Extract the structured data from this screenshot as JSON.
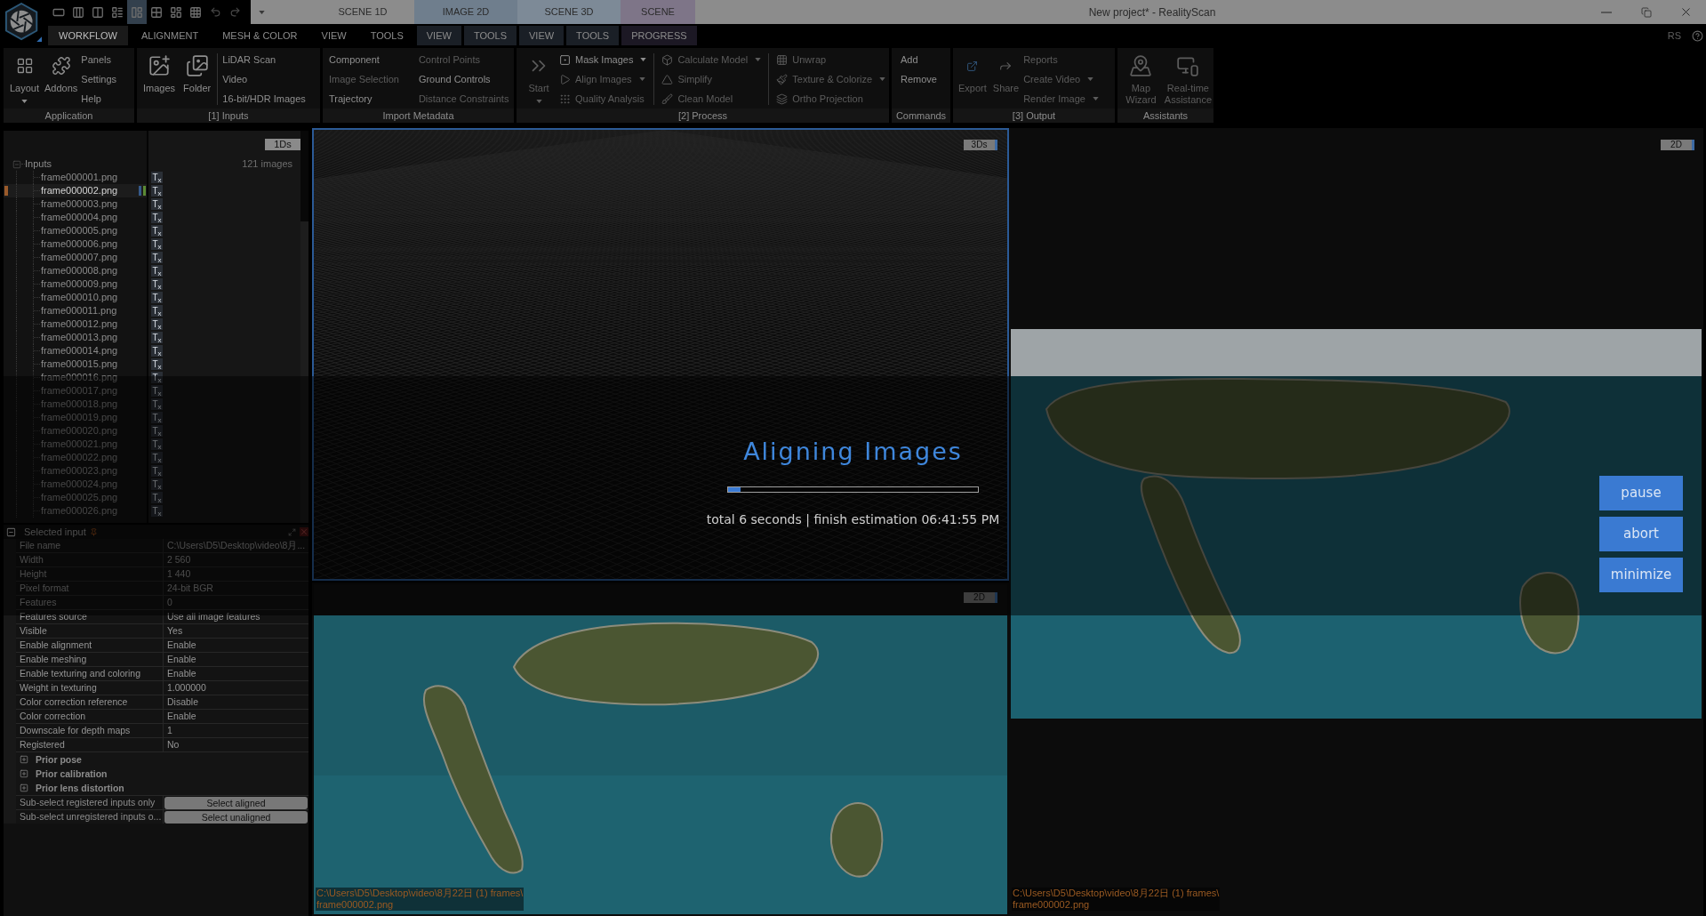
{
  "title_bar": {
    "layout_buttons": [
      {
        "selected": false
      },
      {
        "selected": false
      },
      {
        "selected": false
      },
      {
        "selected": false
      },
      {
        "selected": true
      },
      {
        "selected": false
      },
      {
        "selected": false
      },
      {
        "selected": false
      }
    ],
    "panes": [
      {
        "label": "SCENE 1D",
        "color": "#8c8c8c"
      },
      {
        "label": "IMAGE 2D",
        "color": "#6f7e8d"
      },
      {
        "label": "SCENE 3D",
        "color": "#7d8a97"
      },
      {
        "label": "SCENE",
        "color": "#7e7588"
      }
    ],
    "title": "New project* - RealityScan"
  },
  "tabs_row": {
    "tabs": [
      {
        "label": "WORKFLOW",
        "selected": true
      },
      {
        "label": "ALIGNMENT",
        "selected": false
      },
      {
        "label": "MESH & COLOR",
        "selected": false
      },
      {
        "label": "VIEW",
        "selected": false
      },
      {
        "label": "TOOLS",
        "selected": false
      },
      {
        "label": "VIEW",
        "selected": false,
        "color": "#1a1f26"
      },
      {
        "label": "TOOLS",
        "selected": false,
        "color": "#1a1f26"
      },
      {
        "label": "VIEW",
        "selected": false,
        "color": "#1a1f26"
      },
      {
        "label": "TOOLS",
        "selected": false,
        "color": "#1a1f26"
      },
      {
        "label": "PROGRESS",
        "selected": false,
        "color": "#1c1824"
      }
    ],
    "account": "RS"
  },
  "ribbon": [
    {
      "label": "Application",
      "sections": [
        {
          "kind": "large",
          "label": "Layout",
          "dropdown": true,
          "disabled": false
        },
        {
          "kind": "large",
          "label": "Addons",
          "dropdown": false,
          "disabled": false
        },
        {
          "kind": "stack",
          "items": [
            {
              "label": "Panels",
              "dropdown": false,
              "disabled": false
            },
            {
              "label": "Settings",
              "dropdown": false,
              "disabled": false
            },
            {
              "label": "Help",
              "dropdown": false,
              "disabled": false
            }
          ]
        }
      ]
    },
    {
      "label": "[1] Inputs",
      "sections": [
        {
          "kind": "large",
          "label": "Images",
          "dropdown": false,
          "disabled": false
        },
        {
          "kind": "large",
          "label": "Folder",
          "dropdown": false,
          "disabled": false
        },
        {
          "kind": "stack",
          "separator": true,
          "items": [
            {
              "label": "LiDAR Scan",
              "dropdown": false,
              "disabled": false
            },
            {
              "label": "Video",
              "dropdown": false,
              "disabled": false
            },
            {
              "label": "16-bit/HDR Images",
              "dropdown": false,
              "disabled": false
            }
          ]
        }
      ]
    },
    {
      "label": "Import Metadata",
      "sections": [
        {
          "kind": "stack",
          "items": [
            {
              "label": "Component",
              "dropdown": false,
              "disabled": false
            },
            {
              "label": "Image Selection",
              "dropdown": false,
              "disabled": true
            },
            {
              "label": "Trajectory",
              "dropdown": false,
              "disabled": false
            }
          ]
        },
        {
          "kind": "stack",
          "items": [
            {
              "label": "Control Points",
              "dropdown": false,
              "disabled": true
            },
            {
              "label": "Ground Controls",
              "dropdown": false,
              "disabled": false
            },
            {
              "label": "Distance Constraints",
              "dropdown": false,
              "disabled": true
            }
          ]
        }
      ]
    },
    {
      "label": "[2] Process",
      "sections": [
        {
          "kind": "large",
          "label": "Start",
          "dropdown": true,
          "disabled": true
        },
        {
          "kind": "stack",
          "items": [
            {
              "label": "Mask Images",
              "dropdown": true,
              "disabled": false
            },
            {
              "label": "Align Images",
              "dropdown": true,
              "disabled": true
            },
            {
              "label": "Quality Analysis",
              "dropdown": false,
              "disabled": true
            }
          ]
        },
        {
          "kind": "stack",
          "separator": true,
          "items": [
            {
              "label": "Calculate Model",
              "dropdown": true,
              "disabled": true
            },
            {
              "label": "Simplify",
              "dropdown": false,
              "disabled": true
            },
            {
              "label": "Clean Model",
              "dropdown": false,
              "disabled": true
            }
          ]
        },
        {
          "kind": "stack",
          "separator": true,
          "items": [
            {
              "label": "Unwrap",
              "dropdown": false,
              "disabled": true
            },
            {
              "label": "Texture & Colorize",
              "dropdown": true,
              "disabled": true
            },
            {
              "label": "Ortho Projection",
              "dropdown": false,
              "disabled": true
            }
          ]
        }
      ]
    },
    {
      "label": "Commands",
      "sections": [
        {
          "kind": "stack",
          "items": [
            {
              "label": "Add",
              "dropdown": false,
              "disabled": false
            },
            {
              "label": "Remove",
              "dropdown": false,
              "disabled": false
            }
          ]
        }
      ]
    },
    {
      "label": "[3] Output",
      "sections": [
        {
          "kind": "large",
          "label": "Export",
          "dropdown": false,
          "disabled": true
        },
        {
          "kind": "large",
          "label": "Share",
          "dropdown": false,
          "disabled": true
        },
        {
          "kind": "stack",
          "items": [
            {
              "label": "Reports",
              "dropdown": false,
              "disabled": true
            },
            {
              "label": "Create Video",
              "dropdown": true,
              "disabled": true
            },
            {
              "label": "Render Image",
              "dropdown": true,
              "disabled": true
            }
          ]
        }
      ]
    },
    {
      "label": "Assistants",
      "sections": [
        {
          "kind": "large",
          "label": "Map Wizard",
          "dropdown": false,
          "disabled": true
        },
        {
          "kind": "large",
          "label": "Real-time Assistance",
          "dropdown": false,
          "disabled": true
        }
      ]
    }
  ],
  "inputs_panel": {
    "badge": "1Ds",
    "root": {
      "label": "Inputs",
      "expanded": true,
      "count": "121 images",
      "children": [
        {
          "label": "frame000001.png",
          "selected": false,
          "tag": "T$_{x}$"
        },
        {
          "label": "frame000002.png",
          "selected": true,
          "tag": "T$_{x}$"
        },
        {
          "label": "frame000003.png",
          "selected": false,
          "tag": "T$_{x}$"
        },
        {
          "label": "frame000004.png",
          "selected": false,
          "tag": "T$_{x}$"
        },
        {
          "label": "frame000005.png",
          "selected": false,
          "tag": "T$_{x}$"
        },
        {
          "label": "frame000006.png",
          "selected": false,
          "tag": "T$_{x}$"
        },
        {
          "label": "frame000007.png",
          "selected": false,
          "tag": "T$_{x}$"
        },
        {
          "label": "frame000008.png",
          "selected": false,
          "tag": "T$_{x}$"
        },
        {
          "label": "frame000009.png",
          "selected": false,
          "tag": "T$_{x}$"
        },
        {
          "label": "frame000010.png",
          "selected": false,
          "tag": "T$_{x}$"
        },
        {
          "label": "frame000011.png",
          "selected": false,
          "tag": "T$_{x}$"
        },
        {
          "label": "frame000012.png",
          "selected": false,
          "tag": "T$_{x}$"
        },
        {
          "label": "frame000013.png",
          "selected": false,
          "tag": "T$_{x}$"
        },
        {
          "label": "frame000014.png",
          "selected": false,
          "tag": "T$_{x}$"
        },
        {
          "label": "frame000015.png",
          "selected": false,
          "tag": "T$_{x}$"
        },
        {
          "label": "frame000016.png",
          "selected": false,
          "tag": "T$_{x}$"
        },
        {
          "label": "frame000017.png",
          "selected": false,
          "tag": "T$_{x}$"
        },
        {
          "label": "frame000018.png",
          "selected": false,
          "tag": "T$_{x}$"
        },
        {
          "label": "frame000019.png",
          "selected": false,
          "tag": "T$_{x}$"
        },
        {
          "label": "frame000020.png",
          "selected": false,
          "tag": "T$_{x}$"
        },
        {
          "label": "frame000021.png",
          "selected": false,
          "tag": "T$_{x}$"
        },
        {
          "label": "frame000022.png",
          "selected": false,
          "tag": "T$_{x}$"
        },
        {
          "label": "frame000023.png",
          "selected": false,
          "tag": "T$_{x}$"
        },
        {
          "label": "frame000024.png",
          "selected": false,
          "tag": "T$_{x}$"
        },
        {
          "label": "frame000025.png",
          "selected": false,
          "tag": "T$_{x}$"
        },
        {
          "label": "frame000026.png",
          "selected": false,
          "tag": "T$_{x}$"
        }
      ]
    }
  },
  "selected_input": {
    "title": "Selected input",
    "expanded": true,
    "properties": [
      {
        "label": "File name",
        "value": "C:\\Users\\D5\\Desktop\\video\\8月..."
      },
      {
        "label": "Width",
        "value": "2 560"
      },
      {
        "label": "Height",
        "value": "1 440"
      },
      {
        "label": "Pixel format",
        "value": "24-bit BGR"
      },
      {
        "label": "Features",
        "value": "0"
      },
      {
        "label": "Features source",
        "value": "Use all image features"
      },
      {
        "label": "Visible",
        "value": "Yes"
      },
      {
        "label": "Enable alignment",
        "value": "Enable"
      },
      {
        "label": "Enable meshing",
        "value": "Enable"
      },
      {
        "label": "Enable texturing and coloring",
        "value": "Enable"
      },
      {
        "label": "Weight in texturing",
        "value": "1.000000"
      },
      {
        "label": "Color correction reference",
        "value": "Disable"
      },
      {
        "label": "Color correction",
        "value": "Enable"
      },
      {
        "label": "Downscale for depth maps",
        "value": "1"
      },
      {
        "label": "Registered",
        "value": "No"
      }
    ],
    "sections": [
      {
        "label": "Prior pose",
        "expanded": false
      },
      {
        "label": "Prior calibration",
        "expanded": false
      },
      {
        "label": "Prior lens distortion",
        "expanded": false
      }
    ],
    "actions": [
      {
        "label": "Sub-select registered inputs only",
        "button": "Select aligned"
      },
      {
        "label": "Sub-select unregistered inputs o...",
        "button": "Select unaligned"
      }
    ]
  },
  "viewports": [
    {
      "kind": "scene",
      "badge": "3Ds",
      "selected": true
    },
    {
      "kind": "image",
      "badge": "2D",
      "selected": false,
      "path": [
        "C:\\Users\\D5\\Desktop\\video\\8月22日 (1) frames\\",
        "frame000002.png"
      ]
    },
    {
      "kind": "image",
      "badge": "2D",
      "selected": false,
      "path": [
        "C:\\Users\\D5\\Desktop\\video\\8月22日 (1) frames\\",
        "frame000002.png"
      ]
    }
  ],
  "progress": {
    "title": "Aligning Images",
    "level": 0.05,
    "status": "total 6 seconds | finish estimation 06:41:55 PM",
    "buttons": [
      "pause",
      "abort",
      "minimize"
    ]
  }
}
